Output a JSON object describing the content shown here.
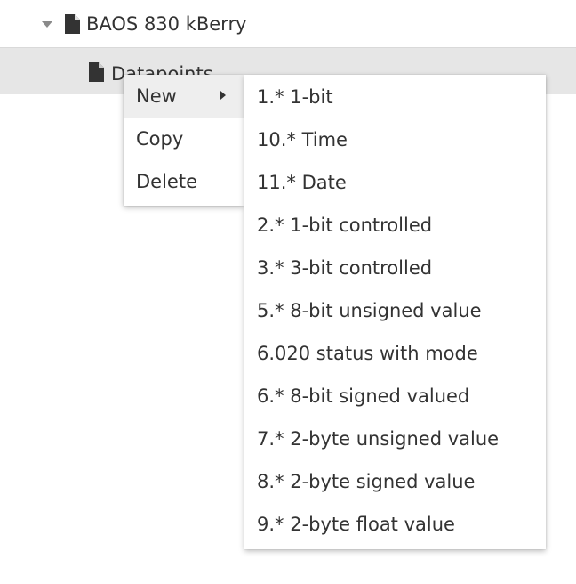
{
  "tree": {
    "root": {
      "label": "BAOS 830 kBerry",
      "expanded": true,
      "icon": "file-icon"
    },
    "child": {
      "label": "Datapoints",
      "selected": true,
      "icon": "file-icon"
    }
  },
  "context_menu": {
    "items": [
      {
        "label": "New",
        "has_submenu": true
      },
      {
        "label": "Copy"
      },
      {
        "label": "Delete"
      }
    ],
    "active_item": "New"
  },
  "submenu": {
    "items": [
      {
        "label": "1.* 1-bit"
      },
      {
        "label": "10.* Time"
      },
      {
        "label": "11.* Date"
      },
      {
        "label": "2.* 1-bit controlled"
      },
      {
        "label": "3.* 3-bit controlled"
      },
      {
        "label": "5.* 8-bit unsigned value"
      },
      {
        "label": "6.020 status with mode"
      },
      {
        "label": "6.* 8-bit signed valued"
      },
      {
        "label": "7.* 2-byte unsigned value"
      },
      {
        "label": "8.* 2-byte signed value"
      },
      {
        "label": "9.* 2-byte float value"
      }
    ]
  },
  "colors": {
    "text": "#333333",
    "selected_row_bg": "#e6e6e6",
    "menu_hover_bg": "#eeeeee",
    "caret": "#8a8a8a"
  }
}
